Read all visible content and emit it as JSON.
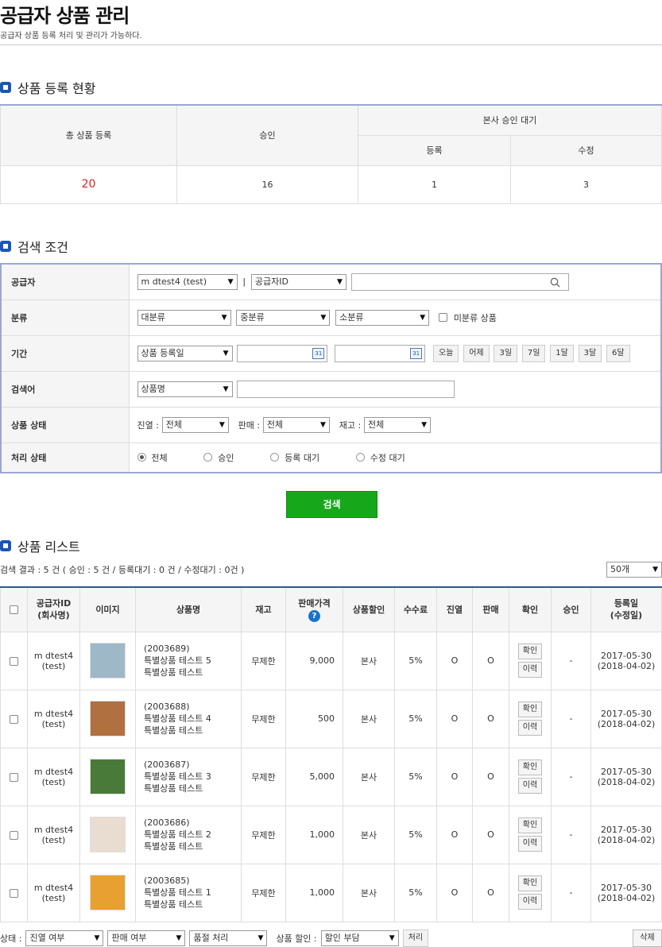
{
  "page": {
    "title": "공급자 상품 관리",
    "description": "공급자 상품 등록 처리 및 관리가 가능하다."
  },
  "status_section": {
    "title": "상품 등록 현황",
    "headers": {
      "total": "총 상품 등록",
      "approved": "승인",
      "pending_group": "본사 승인 대기",
      "pending_register": "등록",
      "pending_modify": "수정"
    },
    "values": {
      "total": "20",
      "approved": "16",
      "pending_register": "1",
      "pending_modify": "3"
    },
    "total_color": "#e02020"
  },
  "search_section": {
    "title": "검색 조건",
    "supplier": {
      "label": "공급자",
      "supplier_select": "m dtest4 (test)",
      "separator": "|",
      "field_select": "공급자ID"
    },
    "category": {
      "label": "분류",
      "large": "대분류",
      "medium": "중분류",
      "small": "소분류",
      "uncategorized_label": "미분류 상품"
    },
    "period": {
      "label": "기간",
      "date_type": "상품 등록일",
      "calendar_icon_text": "31",
      "quick_buttons": [
        "오늘",
        "어제",
        "3일",
        "7일",
        "1달",
        "3달",
        "6달"
      ]
    },
    "keyword": {
      "label": "검색어",
      "field_select": "상품명"
    },
    "product_status": {
      "label": "상품 상태",
      "display_label": "진열 :",
      "display_value": "전체",
      "sale_label": "판매 :",
      "sale_value": "전체",
      "stock_label": "재고 :",
      "stock_value": "전체"
    },
    "process_status": {
      "label": "처리 상태",
      "options": [
        "전체",
        "승인",
        "등록 대기",
        "수정 대기"
      ],
      "selected": "전체"
    },
    "search_button": "검색"
  },
  "list_section": {
    "title": "상품 리스트",
    "result_summary": "검색 결과 : 5 건 ( 승인 : 5 건 / 등록대기 : 0 건 / 수정대기 : 0건 )",
    "per_page": "50개",
    "columns": {
      "supplier_id_line1": "공급자ID",
      "supplier_id_line2": "(회사명)",
      "image": "이미지",
      "name": "상품명",
      "stock": "재고",
      "price": "판매가격",
      "price_help": "?",
      "discount": "상품할인",
      "fee": "수수료",
      "display": "진열",
      "sale": "판매",
      "confirm": "확인",
      "approve": "승인",
      "date_line1": "등록일",
      "date_line2": "(수정일)"
    },
    "row_buttons": {
      "confirm": "확인",
      "history": "이력"
    },
    "rows": [
      {
        "supplier": "m dtest4",
        "company": "(test)",
        "code": "(2003689)",
        "name": "특별상품 테스트 5",
        "sub": "특별상품 테스트",
        "stock": "무제한",
        "price": "9,000",
        "discount": "본사",
        "fee": "5%",
        "display": "O",
        "sale": "O",
        "approve": "-",
        "reg_date": "2017-05-30",
        "mod_date": "(2018-04-02)",
        "thumb_color": "#9fb8c8"
      },
      {
        "supplier": "m dtest4",
        "company": "(test)",
        "code": "(2003688)",
        "name": "특별상품 테스트 4",
        "sub": "특별상품 테스트",
        "stock": "무제한",
        "price": "500",
        "discount": "본사",
        "fee": "5%",
        "display": "O",
        "sale": "O",
        "approve": "-",
        "reg_date": "2017-05-30",
        "mod_date": "(2018-04-02)",
        "thumb_color": "#b07040"
      },
      {
        "supplier": "m dtest4",
        "company": "(test)",
        "code": "(2003687)",
        "name": "특별상품 테스트 3",
        "sub": "특별상품 테스트",
        "stock": "무제한",
        "price": "5,000",
        "discount": "본사",
        "fee": "5%",
        "display": "O",
        "sale": "O",
        "approve": "-",
        "reg_date": "2017-05-30",
        "mod_date": "(2018-04-02)",
        "thumb_color": "#4a7a3a"
      },
      {
        "supplier": "m dtest4",
        "company": "(test)",
        "code": "(2003686)",
        "name": "특별상품 테스트 2",
        "sub": "특별상품 테스트",
        "stock": "무제한",
        "price": "1,000",
        "discount": "본사",
        "fee": "5%",
        "display": "O",
        "sale": "O",
        "approve": "-",
        "reg_date": "2017-05-30",
        "mod_date": "(2018-04-02)",
        "thumb_color": "#e8ddd0"
      },
      {
        "supplier": "m dtest4",
        "company": "(test)",
        "code": "(2003685)",
        "name": "특별상품 테스트 1",
        "sub": "특별상품 테스트",
        "stock": "무제한",
        "price": "1,000",
        "discount": "본사",
        "fee": "5%",
        "display": "O",
        "sale": "O",
        "approve": "-",
        "reg_date": "2017-05-30",
        "mod_date": "(2018-04-02)",
        "thumb_color": "#e8a030"
      }
    ]
  },
  "footer": {
    "status_label": "상태 :",
    "display_select": "진열 여부",
    "sale_select": "판매 여부",
    "soldout_select": "품절 처리",
    "discount_label": "상품 할인 :",
    "discount_select": "할인 부담",
    "process_button": "처리",
    "delete_button": "삭제"
  }
}
